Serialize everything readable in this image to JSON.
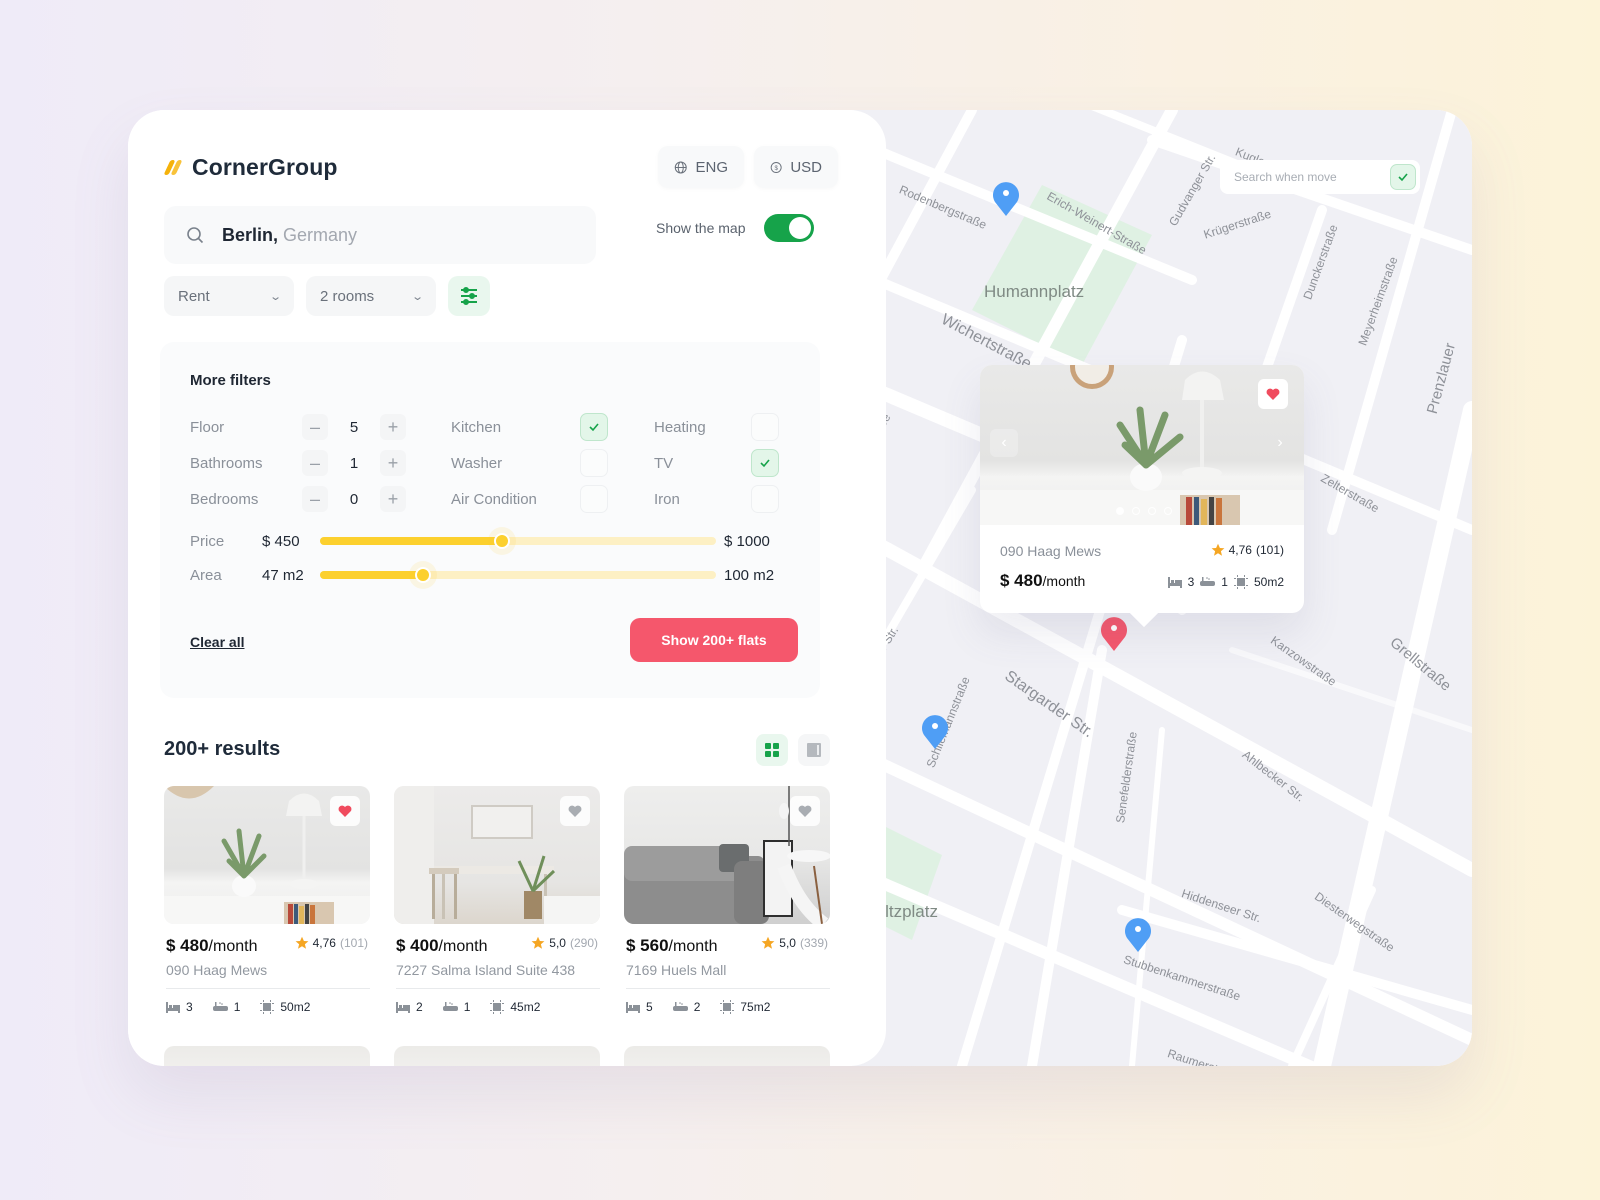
{
  "brand": {
    "name": "CornerGroup"
  },
  "header": {
    "language": "ENG",
    "currency": "USD"
  },
  "search": {
    "city": "Berlin,",
    "country": "Germany"
  },
  "map_toggle": {
    "label": "Show the map",
    "on": true
  },
  "filters": {
    "type": "Rent",
    "rooms": "2 rooms"
  },
  "more_filters": {
    "title": "More filters",
    "steppers": [
      {
        "label": "Floor",
        "value": "5",
        "minus": "–",
        "plus": "+"
      },
      {
        "label": "Bathrooms",
        "value": "1",
        "minus": "–",
        "plus": "+"
      },
      {
        "label": "Bedrooms",
        "value": "0",
        "minus": "–",
        "plus": "+"
      }
    ],
    "amenities": [
      {
        "label": "Kitchen",
        "checked": true
      },
      {
        "label": "Washer",
        "checked": false
      },
      {
        "label": "Air Condition",
        "checked": false
      },
      {
        "label": "Heating",
        "checked": false
      },
      {
        "label": "TV",
        "checked": true
      },
      {
        "label": "Iron",
        "checked": false
      }
    ],
    "price": {
      "label": "Price",
      "min": "$ 450",
      "max": "$ 1000",
      "fill_fraction": 0.46
    },
    "area": {
      "label": "Area",
      "min": "47 m2",
      "max": "100 m2",
      "fill_fraction": 0.26
    },
    "clear_label": "Clear all",
    "submit_label": "Show 200+ flats"
  },
  "results": {
    "title": "200+ results",
    "view_modes": [
      "grid",
      "list"
    ],
    "active_view": "grid",
    "cards": [
      {
        "price": "$ 480",
        "period": "/month",
        "rating": "4,76",
        "reviews": "(101)",
        "address": "090 Haag Mews",
        "beds": "3",
        "baths": "1",
        "area": "50m2",
        "favorite": true
      },
      {
        "price": "$ 400",
        "period": "/month",
        "rating": "5,0",
        "reviews": "(290)",
        "address": "7227 Salma Island Suite 438",
        "beds": "2",
        "baths": "1",
        "area": "45m2",
        "favorite": false
      },
      {
        "price": "$ 560",
        "period": "/month",
        "rating": "5,0",
        "reviews": "(339)",
        "address": "7169 Huels Mall",
        "beds": "5",
        "baths": "2",
        "area": "75m2",
        "favorite": false
      }
    ]
  },
  "map": {
    "search_when_move": {
      "label": "Search when move",
      "checked": true
    },
    "popup": {
      "address": "090 Haag Mews",
      "rating": "4,76",
      "reviews": "(101)",
      "price": "$ 480",
      "period": "/month",
      "beds": "3",
      "baths": "1",
      "area": "50m2",
      "favorite": true,
      "photo_count": 4,
      "active_photo": 1
    },
    "parks": [
      "Humannplatz",
      "mholtzplatz"
    ],
    "streets": [
      "Rodenbergstraße",
      "Erich-Weinert-Straße",
      "Kuglerstraße",
      "Krügerstraße",
      "Gudvanger Str.",
      "Dunckerstraße",
      "Meyerheimstraße",
      "Wichertstraße",
      "Pappelallee",
      "Zelterstraße",
      "Prenzlauer",
      "Stargarder Str.",
      "Lychener Str.",
      "Schliemannstraße",
      "Kanzowstraße",
      "Grellstraße",
      "Ahlbecker Str.",
      "Senefelderstraße",
      "Hiddenseer Str.",
      "Stubbenkammerstraße",
      "Diesterwegstraße",
      "Raumerstraße"
    ],
    "colors": {
      "pin": "#4f9ef5",
      "selected_pin": "#f5576c",
      "park": "#dff1e3"
    }
  },
  "colors": {
    "accent_green": "#16a34a",
    "accent_red": "#f5576c",
    "slider_yellow": "#fcd02e",
    "star": "#f5a623"
  }
}
